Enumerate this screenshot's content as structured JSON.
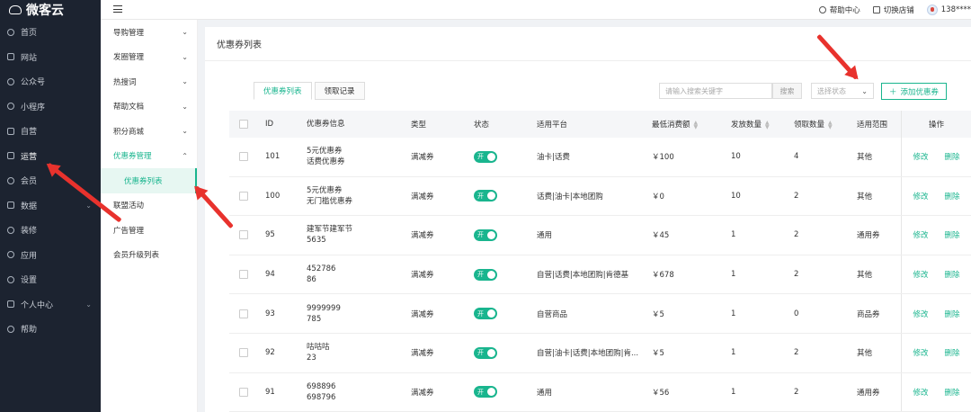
{
  "app": {
    "logo_text": "微客云"
  },
  "sidebar": {
    "items": [
      {
        "label": "首页",
        "icon": "home-icon"
      },
      {
        "label": "网站",
        "icon": "website-icon"
      },
      {
        "label": "公众号",
        "icon": "wechat-icon"
      },
      {
        "label": "小程序",
        "icon": "mini-program-icon"
      },
      {
        "label": "自营",
        "icon": "store-icon"
      },
      {
        "label": "运营",
        "icon": "operations-icon"
      },
      {
        "label": "会员",
        "icon": "member-icon"
      },
      {
        "label": "数据",
        "icon": "data-icon"
      },
      {
        "label": "装修",
        "icon": "decorate-icon"
      },
      {
        "label": "应用",
        "icon": "apps-icon"
      },
      {
        "label": "设置",
        "icon": "gear-icon"
      },
      {
        "label": "个人中心",
        "icon": "user-center-icon"
      },
      {
        "label": "帮助",
        "icon": "help-icon"
      }
    ]
  },
  "header": {
    "help": "帮助中心",
    "switch_store": "切换店铺",
    "user": "138****"
  },
  "submenu": {
    "items": [
      {
        "label": "导购管理"
      },
      {
        "label": "发圈管理"
      },
      {
        "label": "热搜词"
      },
      {
        "label": "帮助文档"
      },
      {
        "label": "积分商城"
      },
      {
        "label": "优惠券管理"
      },
      {
        "label": "优惠券列表"
      },
      {
        "label": "联盟活动"
      },
      {
        "label": "广告管理"
      },
      {
        "label": "会员升级列表"
      }
    ]
  },
  "content": {
    "title": "优惠券列表",
    "tabs": [
      "优惠券列表",
      "领取记录"
    ],
    "search_placeholder": "请输入搜索关键字",
    "search_button": "搜索",
    "status_placeholder": "选择状态",
    "add_button": "添加优惠券"
  },
  "table": {
    "headers": {
      "id": "ID",
      "info": "优惠券信息",
      "type": "类型",
      "status": "状态",
      "platform": "适用平台",
      "min_spend": "最低消费额",
      "issued": "发放数量",
      "received": "领取数量",
      "scope": "适用范围",
      "ops": "操作"
    },
    "toggle_label": "开",
    "edit_label": "修改",
    "delete_label": "删除",
    "rows": [
      {
        "id": "101",
        "info1": "5元优惠券",
        "info2": "话费优惠券",
        "type": "满减券",
        "platform": "油卡|话费",
        "min": "￥100",
        "issued": "10",
        "received": "4",
        "scope": "其他"
      },
      {
        "id": "100",
        "info1": "5元优惠券",
        "info2": "无门槛优惠券",
        "type": "满减券",
        "platform": "话费|油卡|本地团购",
        "min": "￥0",
        "issued": "10",
        "received": "2",
        "scope": "其他"
      },
      {
        "id": "95",
        "info1": "建军节建军节",
        "info2": "5635",
        "type": "满减券",
        "platform": "通用",
        "min": "￥45",
        "issued": "1",
        "received": "2",
        "scope": "通用券"
      },
      {
        "id": "94",
        "info1": "452786",
        "info2": "86",
        "type": "满减券",
        "platform": "自营|话费|本地团购|肯德基",
        "min": "￥678",
        "issued": "1",
        "received": "2",
        "scope": "其他"
      },
      {
        "id": "93",
        "info1": "9999999",
        "info2": "785",
        "type": "满减券",
        "platform": "自营商品",
        "min": "￥5",
        "issued": "1",
        "received": "0",
        "scope": "商品券"
      },
      {
        "id": "92",
        "info1": "咕咕咕",
        "info2": "23",
        "type": "满减券",
        "platform": "自营|油卡|话费|本地团购|肯...",
        "min": "￥5",
        "issued": "1",
        "received": "2",
        "scope": "其他"
      },
      {
        "id": "91",
        "info1": "698896",
        "info2": "698796",
        "type": "满减券",
        "platform": "通用",
        "min": "￥56",
        "issued": "1",
        "received": "2",
        "scope": "通用券"
      }
    ]
  },
  "colors": {
    "sidebar_bg": "#1c2330",
    "accent": "#19b58e",
    "annotation": "#e8322d"
  }
}
